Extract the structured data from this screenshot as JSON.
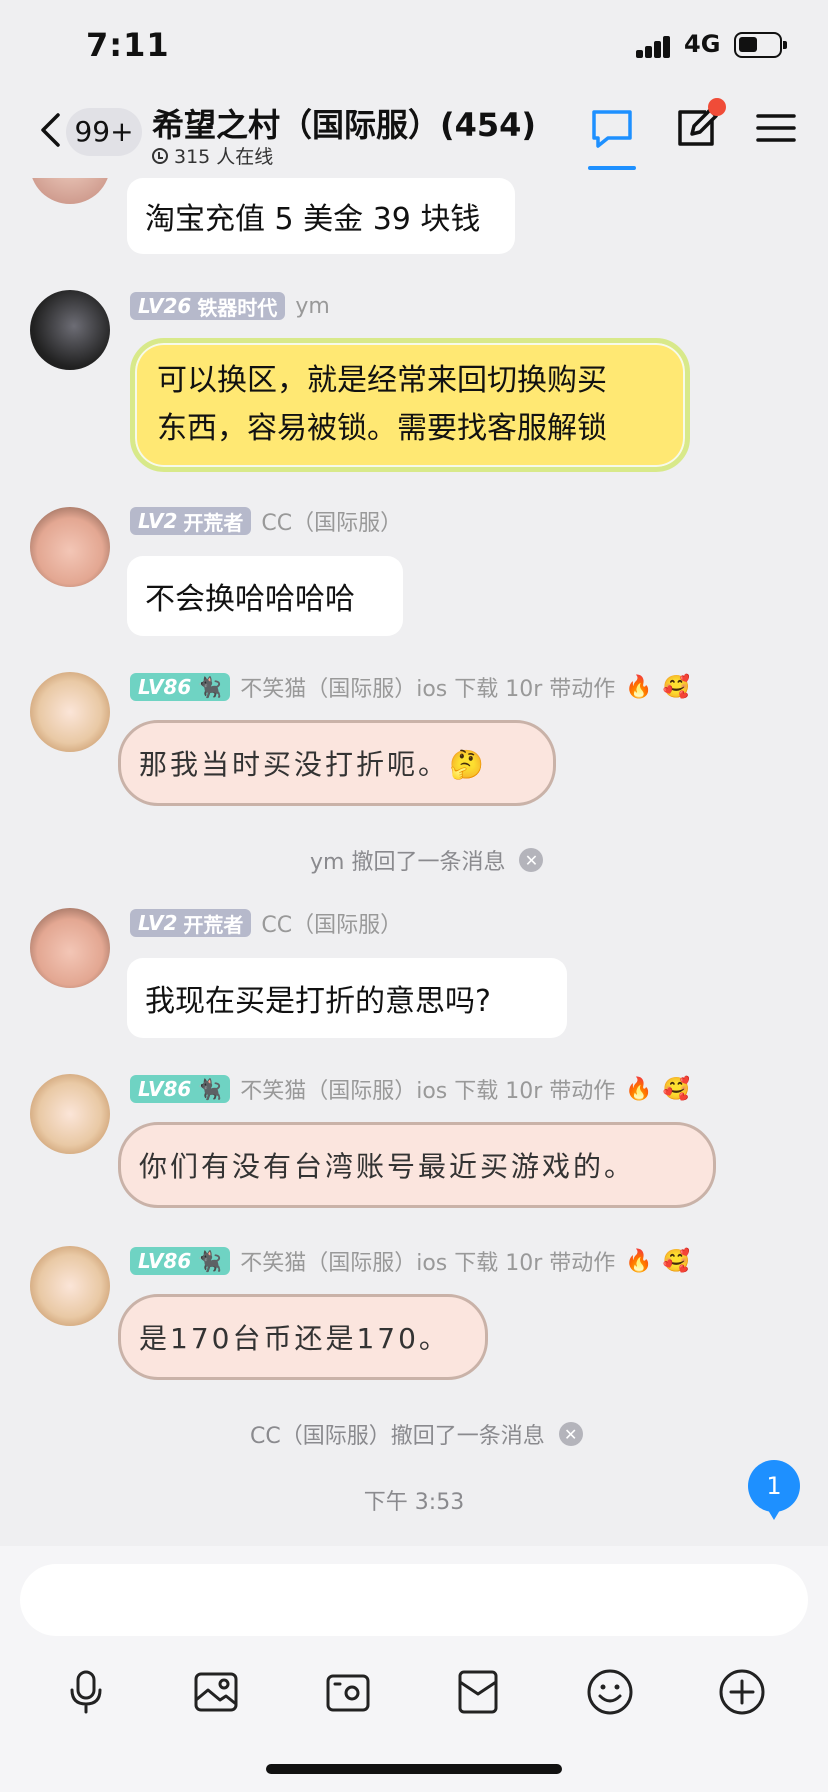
{
  "status_bar": {
    "time": "7:11",
    "network": "4G"
  },
  "header": {
    "back_badge": "99+",
    "title": "希望之村（国际服）(454)",
    "online_text": "315 人在线",
    "icons": [
      "chevron-left-icon",
      "chat-bubble-icon",
      "edit-icon",
      "menu-icon"
    ],
    "accent": "#1e90ff",
    "notify_dot_color": "#f04c38"
  },
  "messages": [
    {
      "text": "淘宝充值 5 美金 39 块钱"
    },
    {
      "level": "LV26",
      "title": "铁器时代",
      "nickname": "ym",
      "lines": [
        "可以换区，就是经常来回切换购买",
        "东西，容易被锁。需要找客服解锁"
      ]
    },
    {
      "level": "LV2",
      "title": "开荒者",
      "nickname": "CC（国际服）",
      "text": "不会换哈哈哈哈"
    },
    {
      "level": "LV86",
      "nickname": "不笑猫（国际服）ios 下载 10r 带动作",
      "text": "那我当时买没打折呃。🤔"
    },
    {
      "level": "LV2",
      "title": "开荒者",
      "nickname": "CC（国际服）",
      "text": "我现在买是打折的意思吗?"
    },
    {
      "level": "LV86",
      "nickname": "不笑猫（国际服）ios 下载 10r 带动作",
      "text": "你们有没有台湾账号最近买游戏的。"
    },
    {
      "level": "LV86",
      "nickname": "不笑猫（国际服）ios 下载 10r 带动作",
      "text": "是170台币还是170。"
    }
  ],
  "recalls": [
    "ym 撤回了一条消息",
    "CC（国际服）撤回了一条消息"
  ],
  "time_separator": "下午 3:53",
  "unread_count": "1",
  "toolbar": {
    "icons": [
      "microphone-icon",
      "image-icon",
      "camera-icon",
      "red-packet-icon",
      "emoji-icon",
      "plus-icon"
    ]
  }
}
